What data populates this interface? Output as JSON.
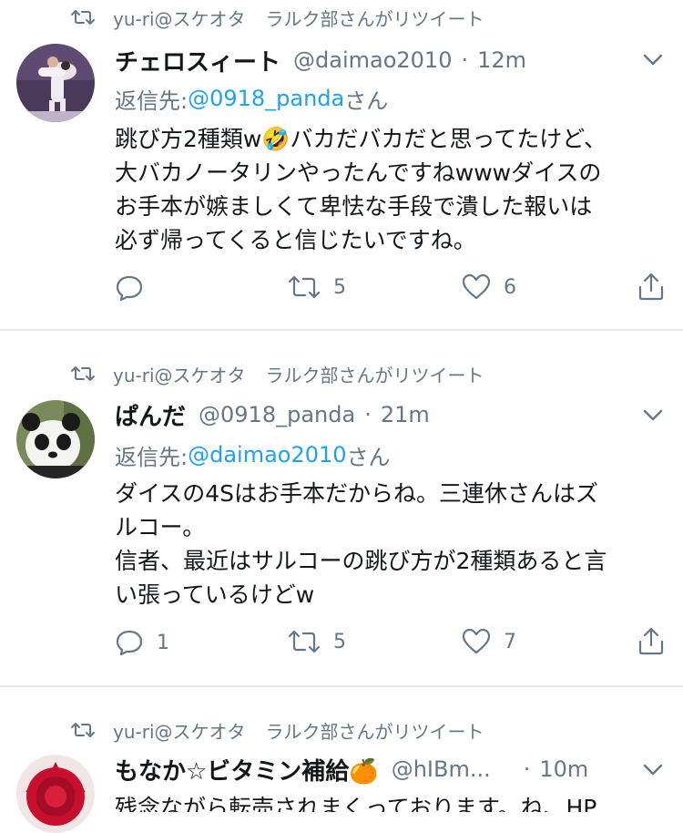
{
  "tweets": [
    {
      "retweet_by": "yu-ri@スケオタ",
      "retweet_label": "ラルク部さんがリツイート",
      "name": "チェロスィート",
      "handle": "@daimao2010",
      "separator": "·",
      "time": "12m",
      "reply_prefix": "返信先: ",
      "reply_to": "@0918_panda",
      "reply_suffix": "さん",
      "text_lines": [
        "跳び方2種類w🤣バカだバカだと思ってたけど、",
        "大バカノータリンやったんですねwwwダイスの",
        "お手本が嫉ましくて卑怯な手段で潰した報いは",
        "必ず帰ってくると信じたいですね。"
      ],
      "replies": "",
      "retweets": "5",
      "likes": "6",
      "avatar_icon": "skater-pair-photo"
    },
    {
      "retweet_by": "yu-ri@スケオタ",
      "retweet_label": "ラルク部さんがリツイート",
      "name": "ぱんだ",
      "handle": "@0918_panda",
      "separator": "·",
      "time": "21m",
      "reply_prefix": "返信先: ",
      "reply_to": "@daimao2010",
      "reply_suffix": "さん",
      "text_lines": [
        "ダイスの4Sはお手本だからね。三連休さんはズ",
        "ルコー。",
        "信者、最近はサルコーの跳び方が2種類あると言",
        "い張っているけどw"
      ],
      "replies": "1",
      "retweets": "5",
      "likes": "7",
      "avatar_icon": "panda-photo"
    },
    {
      "retweet_by": "yu-ri@スケオタ",
      "retweet_label": "ラルク部さんがリツイート",
      "name": "もなか☆ビタミン補給🍊",
      "handle": "@hIBm...",
      "separator": "·",
      "time": "10m",
      "text_partial": "残念ながら転売されまくっております。ね、HP",
      "avatar_icon": "red-flower-photo"
    }
  ],
  "colors": {
    "text": "#14171a",
    "secondary": "#657786",
    "link": "#1da1f2",
    "divider": "#e6ecf0"
  }
}
